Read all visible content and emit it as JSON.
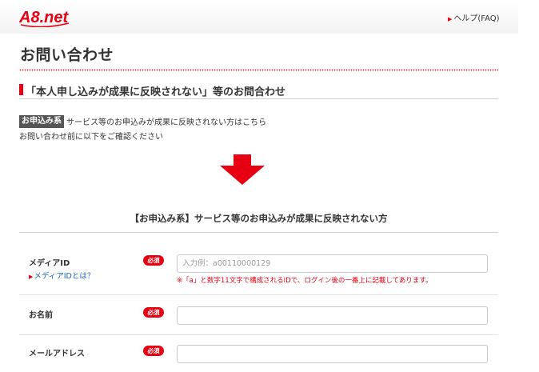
{
  "header": {
    "logo": "A8.net",
    "help_link": "ヘルプ(FAQ)"
  },
  "page": {
    "title": "お問い合わせ"
  },
  "section": {
    "heading": "「本人申し込みが成果に反映されない」等のお問合わせ"
  },
  "info": {
    "badge": "お申込み系",
    "description": "サービス等のお申込みが成果に反映されない方はこちら",
    "instruction": "お問い合わせ前に以下をご確認ください"
  },
  "form": {
    "title": "【お申込み系】サービス等のお申込みが成果に反映されない方",
    "required_label": "必須",
    "fields": [
      {
        "label": "メディアID",
        "sub_link": "メディアIDとは？",
        "placeholder": "入力例：a00110000129",
        "value": "",
        "note": "※「a」と数字11文字で構成されるIDで、ログイン後の一番上に記載してあります。"
      },
      {
        "label": "お名前",
        "placeholder": "",
        "value": ""
      },
      {
        "label": "メールアドレス",
        "placeholder": "",
        "value": ""
      }
    ]
  },
  "colors": {
    "accent": "#e60012",
    "link": "#1a66c4",
    "badge_dark": "#555555"
  },
  "icons": {
    "logo": "a8net-logo",
    "help": "triangle-right-icon",
    "arrow": "down-arrow-icon"
  }
}
